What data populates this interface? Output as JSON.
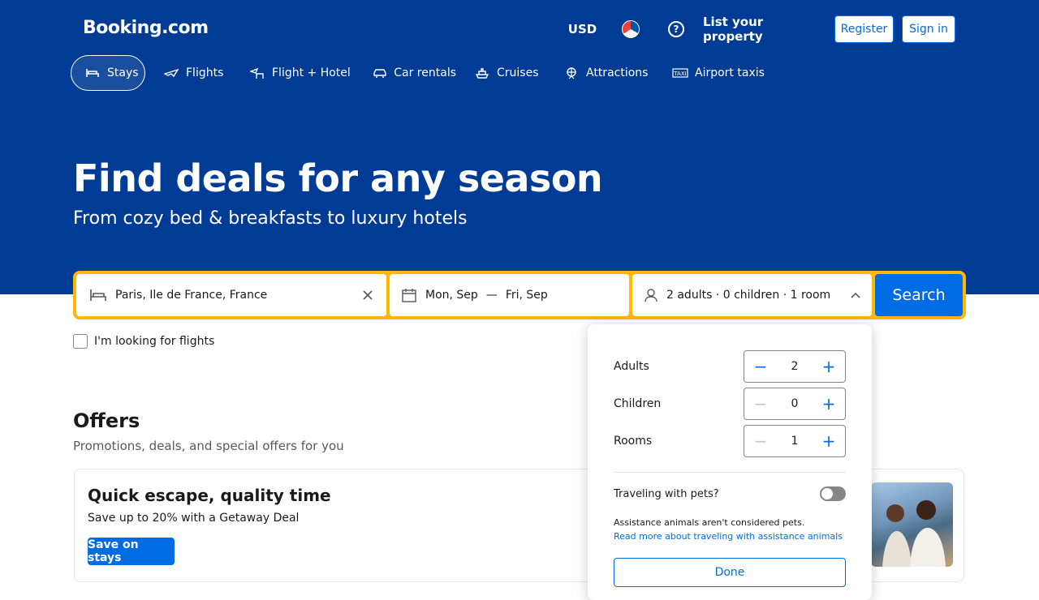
{
  "header": {
    "logo": "Booking.com",
    "currency": "USD",
    "list_property": "List your property",
    "register": "Register",
    "signin": "Sign in"
  },
  "nav": {
    "tabs": [
      {
        "label": "Stays",
        "icon": "bed-icon"
      },
      {
        "label": "Flights",
        "icon": "plane-icon"
      },
      {
        "label": "Flight + Hotel",
        "icon": "flight-hotel-icon"
      },
      {
        "label": "Car rentals",
        "icon": "car-icon"
      },
      {
        "label": "Cruises",
        "icon": "ship-icon"
      },
      {
        "label": "Attractions",
        "icon": "attractions-icon"
      },
      {
        "label": "Airport taxis",
        "icon": "taxi-icon"
      }
    ]
  },
  "hero": {
    "title": "Find deals for any season",
    "subtitle": "From cozy bed & breakfasts to luxury hotels"
  },
  "search": {
    "destination": "Paris, Ile de France, France",
    "checkin": "Mon, Sep",
    "checkout": "Fri, Sep",
    "occupancy": "2 adults · 0 children · 1 room",
    "button": "Search",
    "flights_checkbox": "I'm looking for flights"
  },
  "occupancy_popover": {
    "adults_label": "Adults",
    "adults_value": "2",
    "children_label": "Children",
    "children_value": "0",
    "rooms_label": "Rooms",
    "rooms_value": "1",
    "pets_label": "Traveling with pets?",
    "pets_note": "Assistance animals aren't considered pets.",
    "pets_link": "Read more about traveling with assistance animals",
    "done": "Done"
  },
  "offers": {
    "title": "Offers",
    "subtitle": "Promotions, deals, and special offers for you",
    "card_title": "Quick escape, quality time",
    "card_text": "Save up to 20% with a Getaway Deal",
    "card_button": "Save on stays"
  },
  "colors": {
    "brand_blue": "#003b95",
    "accent_blue": "#006ce4",
    "search_yellow": "#ffb700"
  }
}
